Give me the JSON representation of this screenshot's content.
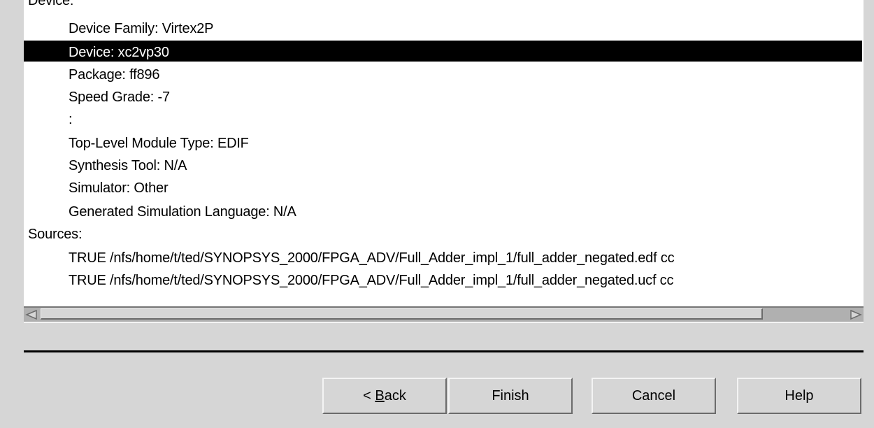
{
  "summary": {
    "device_header_partial": "Device:",
    "device_family": "Device Family: Virtex2P",
    "device": "Device: xc2vp30",
    "package": "Package: ff896",
    "speed_grade": "Speed Grade: -7",
    "colon_line": ":",
    "top_level_module_type": "Top-Level Module Type: EDIF",
    "synthesis_tool": "Synthesis Tool: N/A",
    "simulator": "Simulator: Other",
    "generated_sim_language": "Generated Simulation Language: N/A",
    "sources_header": "Sources:",
    "sources": [
      "TRUE /nfs/home/t/ted/SYNOPSYS_2000/FPGA_ADV/Full_Adder_impl_1/full_adder_negated.edf cc",
      "TRUE /nfs/home/t/ted/SYNOPSYS_2000/FPGA_ADV/Full_Adder_impl_1/full_adder_negated.ucf cc"
    ]
  },
  "buttons": {
    "back_prefix": "< ",
    "back_mnemonic": "B",
    "back_suffix": "ack",
    "finish": "Finish",
    "cancel": "Cancel",
    "help": "Help"
  },
  "icons": {
    "scroll_left": "scroll-left-arrow-icon",
    "scroll_right": "scroll-right-arrow-icon"
  }
}
